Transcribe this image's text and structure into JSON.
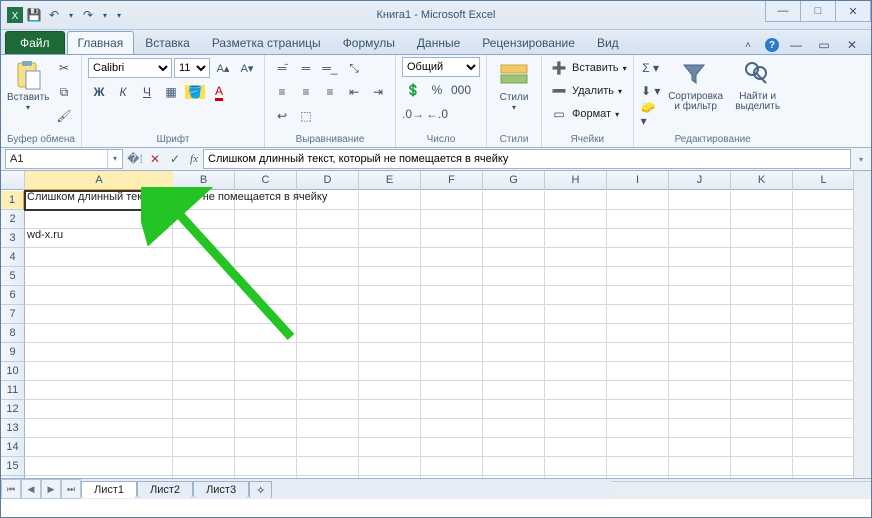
{
  "window": {
    "title": "Книга1 - Microsoft Excel",
    "sys": {
      "min": "—",
      "max": "□",
      "close": "✕"
    }
  },
  "qat": {
    "save": "💾",
    "undo": "↶",
    "redo": "↷"
  },
  "tabs": {
    "file": "Файл",
    "items": [
      "Главная",
      "Вставка",
      "Разметка страницы",
      "Формулы",
      "Данные",
      "Рецензирование",
      "Вид"
    ],
    "active": 0
  },
  "ribbon": {
    "clipboard": {
      "label": "Буфер обмена",
      "paste": "Вставить"
    },
    "font": {
      "label": "Шрифт",
      "name": "Calibri",
      "size": "11"
    },
    "align": {
      "label": "Выравнивание"
    },
    "number": {
      "label": "Число",
      "format": "Общий"
    },
    "styles": {
      "label": "Стили",
      "stylebtn": "Стили"
    },
    "cells": {
      "label": "Ячейки",
      "insert": "Вставить",
      "delete": "Удалить",
      "format": "Формат"
    },
    "editing": {
      "label": "Редактирование",
      "sort": "Сортировка\nи фильтр",
      "find": "Найти и\nвыделить"
    }
  },
  "formulabar": {
    "namebox": "A1",
    "fx": "fx",
    "value": "Слишком длинный текст, который не помещается в ячейку"
  },
  "sheet": {
    "cols": [
      "A",
      "B",
      "C",
      "D",
      "E",
      "F",
      "G",
      "H",
      "I",
      "J",
      "K",
      "L"
    ],
    "rows": 16,
    "activeCell": "A1",
    "data": {
      "A1": "Слишком длинный текст, который не помещается в ячейку",
      "A3": "wd-x.ru"
    }
  },
  "sheetTabs": {
    "items": [
      "Лист1",
      "Лист2",
      "Лист3"
    ],
    "active": 0
  }
}
